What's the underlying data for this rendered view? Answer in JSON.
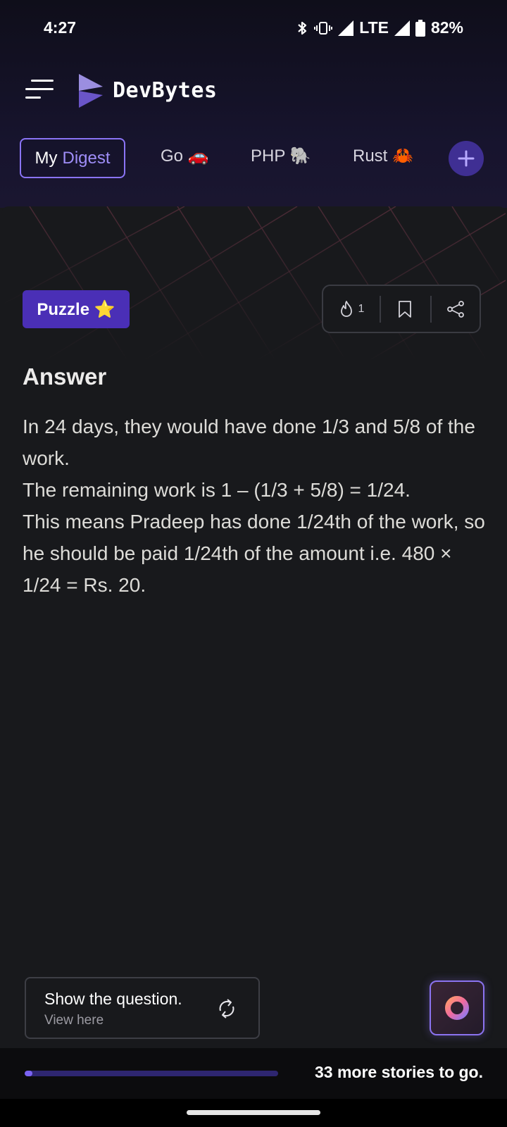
{
  "status": {
    "time": "4:27",
    "network": "LTE",
    "battery": "82%"
  },
  "app": {
    "title": "DevBytes",
    "logo": "devbytes-logo-icon",
    "accent": "#7b63f2"
  },
  "tabs": {
    "digest_word1": "My",
    "digest_word2": "Digest",
    "items": [
      {
        "label": "Go 🚗"
      },
      {
        "label": "PHP 🐘"
      },
      {
        "label": "Rust 🦀"
      }
    ],
    "add_icon": "plus-icon"
  },
  "card": {
    "badge": "Puzzle ⭐",
    "badge_color": "#4a2fb6",
    "fire_count": "1",
    "answer_title": "Answer",
    "answer_lines": [
      "In 24 days, they would have done 1/3 and 5/8 of the work.",
      "The remaining work is 1 – (1/3 + 5/8) = 1/24.",
      "This means Pradeep has done 1/24th of the work, so he should be paid 1/24th of the amount i.e. 480 × 1/24 = Rs. 20."
    ]
  },
  "show_question": {
    "title": "Show the question.",
    "subtitle": "View here"
  },
  "progress": {
    "fraction": 0.03,
    "label": "33 more stories to go."
  }
}
